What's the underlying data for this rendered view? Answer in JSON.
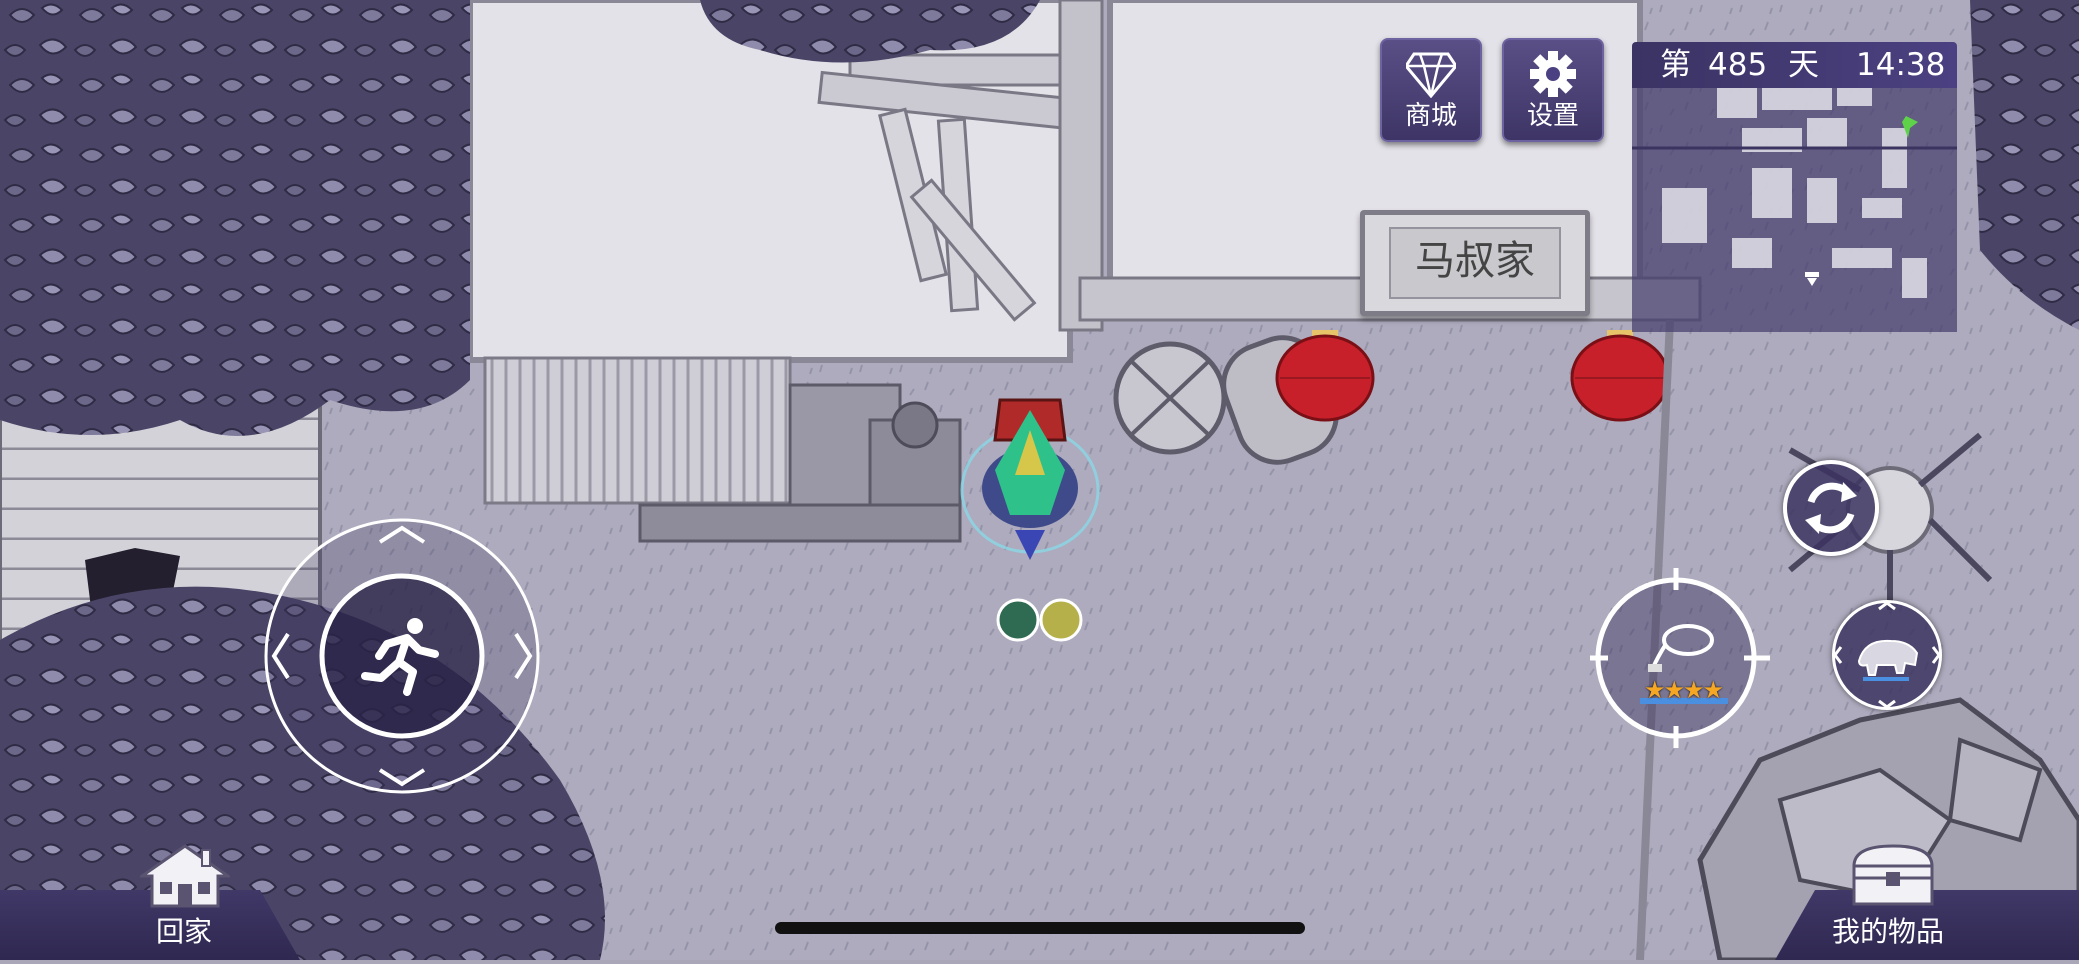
{
  "hud": {
    "shop_label": "商城",
    "settings_label": "设置",
    "day_prefix": "第",
    "day_number": "485",
    "day_suffix": "天",
    "clock": "14:38"
  },
  "map": {
    "location_sign": "马叔家"
  },
  "bottom": {
    "home_label": "回家",
    "items_label": "我的物品"
  },
  "weapon": {
    "star_rating": 4
  },
  "icons": {
    "shop": "diamond-icon",
    "settings": "gear-icon",
    "joystick": "running-man-icon",
    "switch": "refresh-icon",
    "weapon": "whip-icon",
    "pet": "boar-icon",
    "home": "house-icon",
    "items": "chest-icon"
  },
  "colors": {
    "hud_panel": "#4b4182",
    "lantern": "#c8202a",
    "star": "#f5a623",
    "minimap_player": "#5ed34a"
  }
}
